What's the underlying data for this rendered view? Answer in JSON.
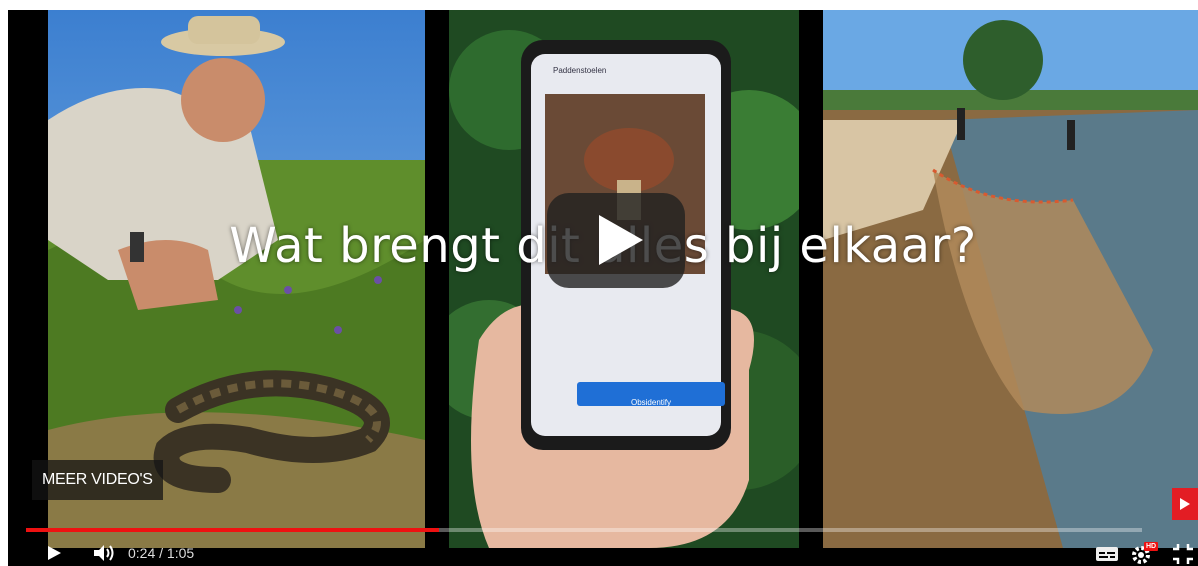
{
  "video": {
    "overlay_title": "Wat brengt dit alles bij elkaar?",
    "more_videos_label": "MEER VIDEO'S",
    "current_time": "0:24",
    "duration": "1:05",
    "progress_fraction": 0.37
  },
  "phone": {
    "app_title": "Paddenstoelen",
    "button_label": "Obsidentify"
  },
  "controls": {
    "hd_badge": "HD",
    "play_icon": "play-icon",
    "volume_icon": "volume-icon",
    "cc_icon": "subtitles-icon",
    "settings_icon": "gear-icon",
    "fullscreen_icon": "exit-fullscreen-icon"
  },
  "colors": {
    "progress": "#ee1111",
    "youtube_red": "#e31d24"
  }
}
